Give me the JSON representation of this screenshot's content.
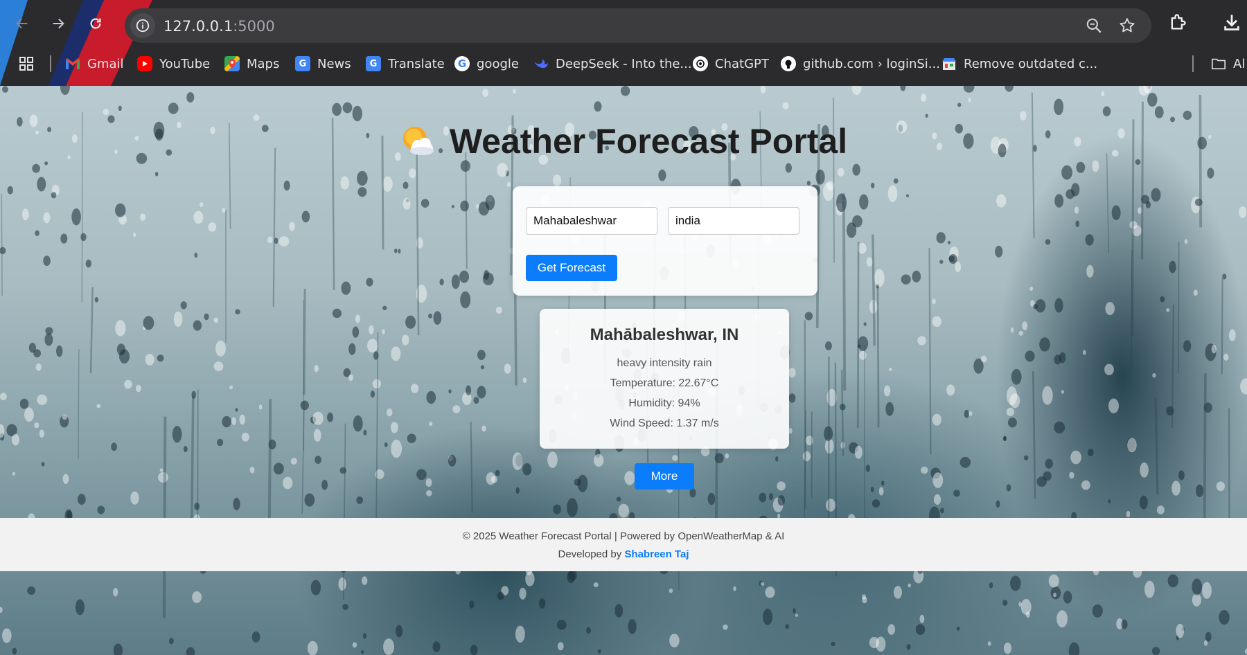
{
  "browser": {
    "url_host": "127.0.0.1",
    "url_port": ":5000",
    "bookmarks": [
      {
        "label": "Gmail",
        "icon": "gmail-icon"
      },
      {
        "label": "YouTube",
        "icon": "youtube-icon"
      },
      {
        "label": "Maps",
        "icon": "maps-icon"
      },
      {
        "label": "News",
        "icon": "news-icon"
      },
      {
        "label": "Translate",
        "icon": "translate-icon"
      },
      {
        "label": "google",
        "icon": "google-icon"
      },
      {
        "label": "DeepSeek - Into the...",
        "icon": "deepseek-icon"
      },
      {
        "label": "ChatGPT",
        "icon": "chatgpt-icon"
      },
      {
        "label": "github.com › loginSi...",
        "icon": "github-icon"
      },
      {
        "label": "Remove outdated c...",
        "icon": "store-icon"
      },
      {
        "label": "Al",
        "icon": "folder-icon"
      }
    ]
  },
  "page": {
    "title": "Weather Forecast Portal",
    "title_icon": "sun-behind-cloud-icon",
    "form": {
      "city_value": "Mahabaleshwar",
      "country_value": "india",
      "submit_label": "Get Forecast"
    },
    "result": {
      "city": "Mahābaleshwar, IN",
      "description": "heavy intensity rain",
      "temperature": "Temperature: 22.67°C",
      "humidity": "Humidity: 94%",
      "wind": "Wind Speed: 1.37 m/s"
    },
    "more_label": "More",
    "footer": {
      "line1": "© 2025 Weather Forecast Portal | Powered by OpenWeatherMap & AI",
      "developed_by": "Developed by",
      "author": "Shabreen Taj"
    }
  },
  "colors": {
    "accent": "#0b7dfa",
    "chrome_bg": "#2b2b2d",
    "omnibox_bg": "#3c3c3f"
  }
}
